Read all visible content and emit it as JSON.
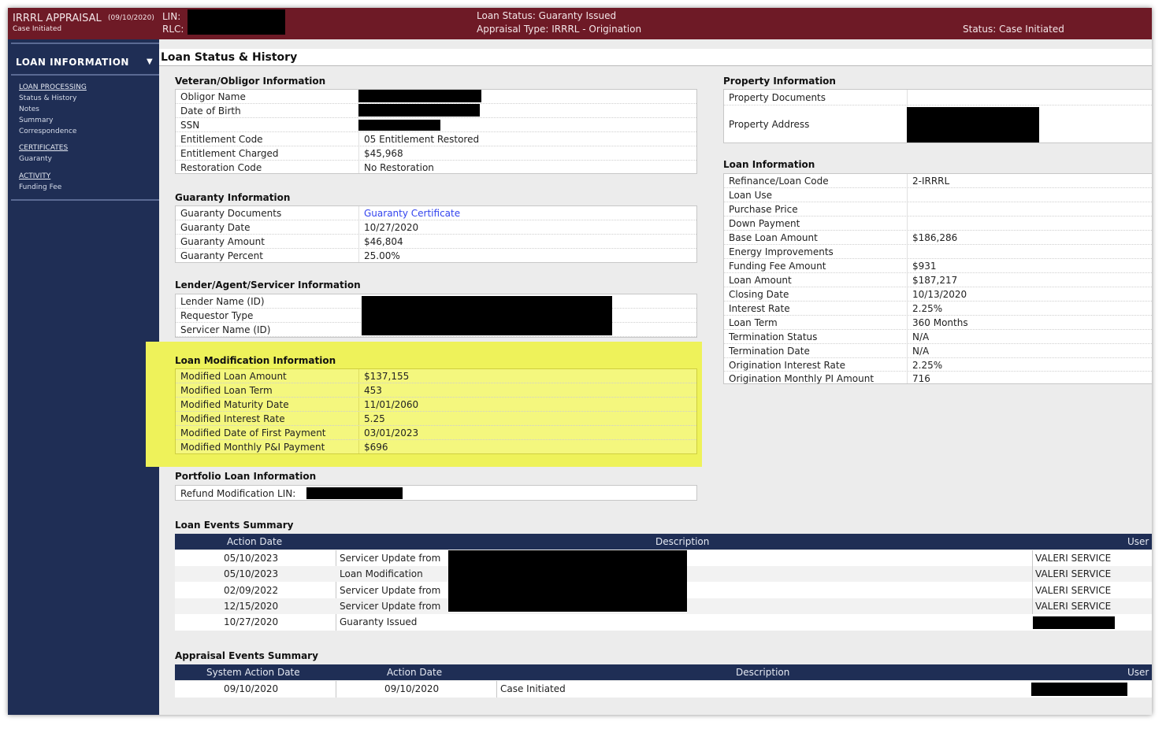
{
  "topbar": {
    "app_title": "IRRRL APPRAISAL",
    "app_date": "(09/10/2020)",
    "app_status": "Case Initiated",
    "lin_label": "LIN:",
    "rlc_label": "RLC:",
    "loan_status": "Loan Status: Guaranty Issued",
    "appraisal_type": "Appraisal Type: IRRRL - Origination",
    "status": "Status: Case Initiated"
  },
  "sidebar": {
    "title": "LOAN INFORMATION",
    "arrow": "▼",
    "sections": [
      {
        "label": "LOAN PROCESSING",
        "links": [
          "Status & History",
          "Notes",
          "Summary",
          "Correspondence"
        ]
      },
      {
        "label": "CERTIFICATES",
        "links": [
          "Guaranty"
        ]
      },
      {
        "label": "ACTIVITY",
        "links": [
          "Funding Fee"
        ]
      }
    ]
  },
  "page_title": "Loan Status & History",
  "veteran": {
    "title": "Veteran/Obligor Information",
    "rows": [
      {
        "label": "Obligor Name",
        "value": ""
      },
      {
        "label": "Date of Birth",
        "value": ""
      },
      {
        "label": "SSN",
        "value": ""
      },
      {
        "label": "Entitlement Code",
        "value": "05 Entitlement Restored"
      },
      {
        "label": "Entitlement Charged",
        "value": "$45,968"
      },
      {
        "label": "Restoration Code",
        "value": "No Restoration"
      }
    ]
  },
  "guaranty": {
    "title": "Guaranty Information",
    "rows": [
      {
        "label": "Guaranty Documents",
        "value": "Guaranty Certificate"
      },
      {
        "label": "Guaranty Date",
        "value": "10/27/2020"
      },
      {
        "label": "Guaranty Amount",
        "value": "$46,804"
      },
      {
        "label": "Guaranty Percent",
        "value": "25.00%"
      }
    ]
  },
  "lender": {
    "title": "Lender/Agent/Servicer Information",
    "rows": [
      {
        "label": "Lender Name (ID)"
      },
      {
        "label": "Requestor Type"
      },
      {
        "label": "Servicer Name (ID)"
      }
    ]
  },
  "modification": {
    "title": "Loan Modification Information",
    "rows": [
      {
        "label": "Modified Loan Amount",
        "value": "$137,155"
      },
      {
        "label": "Modified Loan Term",
        "value": "453"
      },
      {
        "label": "Modified Maturity Date",
        "value": "11/01/2060"
      },
      {
        "label": "Modified Interest Rate",
        "value": "5.25"
      },
      {
        "label": "Modified Date of First Payment",
        "value": "03/01/2023"
      },
      {
        "label": "Modified Monthly P&I Payment",
        "value": "$696"
      }
    ]
  },
  "portfolio": {
    "title": "Portfolio Loan Information",
    "label": "Refund Modification LIN:"
  },
  "property": {
    "title": "Property Information",
    "documents_label": "Property Documents",
    "address_label": "Property Address"
  },
  "loan_info": {
    "title": "Loan Information",
    "rows": [
      {
        "label": "Refinance/Loan Code",
        "value": "2-IRRRL"
      },
      {
        "label": "Loan Use",
        "value": ""
      },
      {
        "label": "Purchase Price",
        "value": ""
      },
      {
        "label": "Down Payment",
        "value": ""
      },
      {
        "label": "Base Loan Amount",
        "value": "$186,286"
      },
      {
        "label": "Energy Improvements",
        "value": ""
      },
      {
        "label": "Funding Fee Amount",
        "value": "$931"
      },
      {
        "label": "Loan Amount",
        "value": "$187,217"
      },
      {
        "label": "Closing Date",
        "value": "10/13/2020"
      },
      {
        "label": "Interest Rate",
        "value": "2.25%"
      },
      {
        "label": "Loan Term",
        "value": "360 Months"
      },
      {
        "label": "Termination Status",
        "value": "N/A"
      },
      {
        "label": "Termination Date",
        "value": "N/A"
      },
      {
        "label": "Origination Interest Rate",
        "value": "2.25%"
      },
      {
        "label": "Origination Monthly PI Amount",
        "value": "716"
      }
    ]
  },
  "loan_events": {
    "title": "Loan Events Summary",
    "headers": [
      "Action Date",
      "Description",
      "User"
    ],
    "rows": [
      {
        "date": "05/10/2023",
        "description": "Servicer Update from",
        "user": "VALERI SERVICE"
      },
      {
        "date": "05/10/2023",
        "description": "Loan Modification",
        "user": "VALERI SERVICE"
      },
      {
        "date": "02/09/2022",
        "description": "Servicer Update from",
        "user": "VALERI SERVICE"
      },
      {
        "date": "12/15/2020",
        "description": "Servicer Update from",
        "user": "VALERI SERVICE"
      },
      {
        "date": "10/27/2020",
        "description": "Guaranty Issued",
        "user": ""
      }
    ]
  },
  "appraisal_events": {
    "title": "Appraisal Events Summary",
    "headers": [
      "System Action Date",
      "Action Date",
      "Description",
      "User"
    ],
    "rows": [
      {
        "system_date": "09/10/2020",
        "action_date": "09/10/2020",
        "description": "Case Initiated",
        "user": ""
      }
    ]
  }
}
